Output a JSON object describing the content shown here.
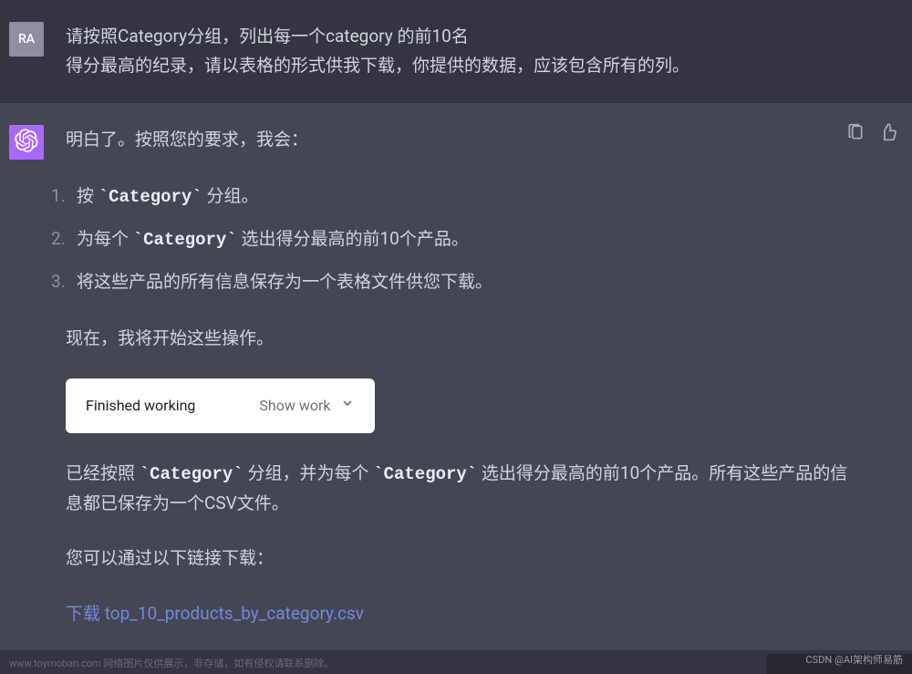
{
  "user": {
    "avatar_initials": "RA",
    "message_line1": "请按照Category分组，列出每一个category 的前10名",
    "message_line2": "得分最高的纪录，请以表格的形式供我下载，你提供的数据，应该包含所有的列。"
  },
  "assistant": {
    "intro": "明白了。按照您的要求，我会：",
    "steps": {
      "1_a": "按 ",
      "1_code": "`Category`",
      "1_b": " 分组。",
      "2_a": "为每个 ",
      "2_code": "`Category`",
      "2_b": " 选出得分最高的前10个产品。",
      "3": "将这些产品的所有信息保存为一个表格文件供您下载。"
    },
    "starting": "现在，我将开始这些操作。",
    "work_panel": {
      "status": "Finished working",
      "toggle": "Show work"
    },
    "result_a": "已经按照 ",
    "result_code1": "`Category`",
    "result_b": " 分组，并为每个 ",
    "result_code2": "`Category`",
    "result_c": " 选出得分最高的前10个产品。所有这些产品的信息都已保存为一个CSV文件。",
    "download_prompt": "您可以通过以下链接下载：",
    "download_link": "下载 top_10_products_by_category.csv"
  },
  "footer": {
    "note": "www.toymoban.com 网络图片仅供展示，非存储，如有侵权请联系删除。",
    "watermark": "CSDN @AI架构师易筋"
  }
}
